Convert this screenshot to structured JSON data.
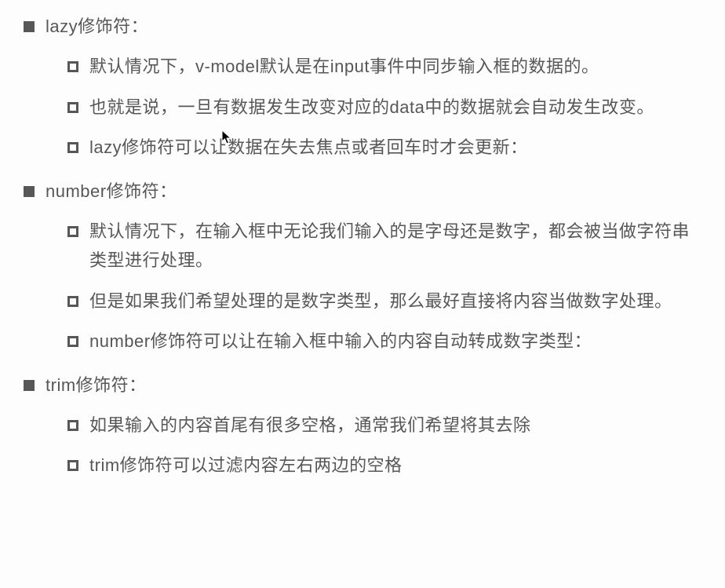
{
  "sections": [
    {
      "title": "lazy修饰符：",
      "items": [
        "默认情况下，v-model默认是在input事件中同步输入框的数据的。",
        "也就是说，一旦有数据发生改变对应的data中的数据就会自动发生改变。",
        "lazy修饰符可以让数据在失去焦点或者回车时才会更新："
      ]
    },
    {
      "title": "number修饰符：",
      "items": [
        "默认情况下，在输入框中无论我们输入的是字母还是数字，都会被当做字符串类型进行处理。",
        "但是如果我们希望处理的是数字类型，那么最好直接将内容当做数字处理。",
        "number修饰符可以让在输入框中输入的内容自动转成数字类型："
      ]
    },
    {
      "title": "trim修饰符：",
      "items": [
        "如果输入的内容首尾有很多空格，通常我们希望将其去除",
        "trim修饰符可以过滤内容左右两边的空格"
      ]
    }
  ]
}
